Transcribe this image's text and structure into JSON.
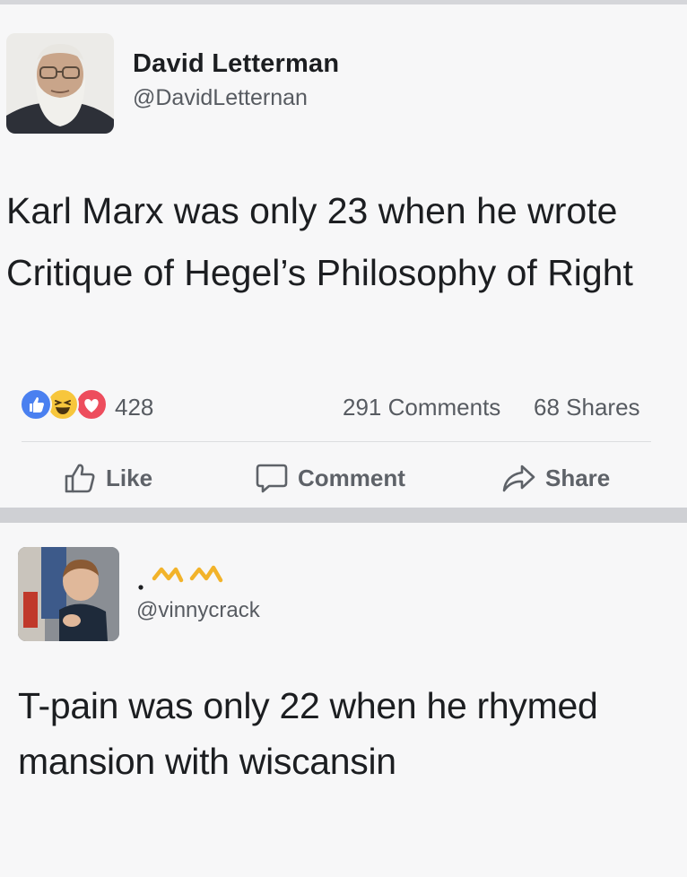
{
  "post1": {
    "author_name": "David Letterman",
    "author_handle": "@DavidLetternan",
    "text": "Karl Marx was only 23 when he wrote Critique of Hegel’s Philosophy of Right",
    "reaction_count": "428",
    "comments_count": "291 Comments",
    "shares_count": "68 Shares",
    "reaction_icons": [
      "like-icon",
      "haha-icon",
      "love-icon"
    ],
    "actions": {
      "like_label": "Like",
      "comment_label": "Comment",
      "share_label": "Share"
    }
  },
  "post2": {
    "author_name_icon": "golden-crown-mark",
    "author_handle": "@vinnycrack",
    "text": "T-pain was only 22 when he rhymed mansion with wiscansin"
  },
  "colors": {
    "like_blue": "#4a80f0",
    "haha_yellow": "#f7c63c",
    "love_red": "#ed4d5d",
    "section_bar": "#cfd0d4",
    "background": "#f7f7f8"
  }
}
